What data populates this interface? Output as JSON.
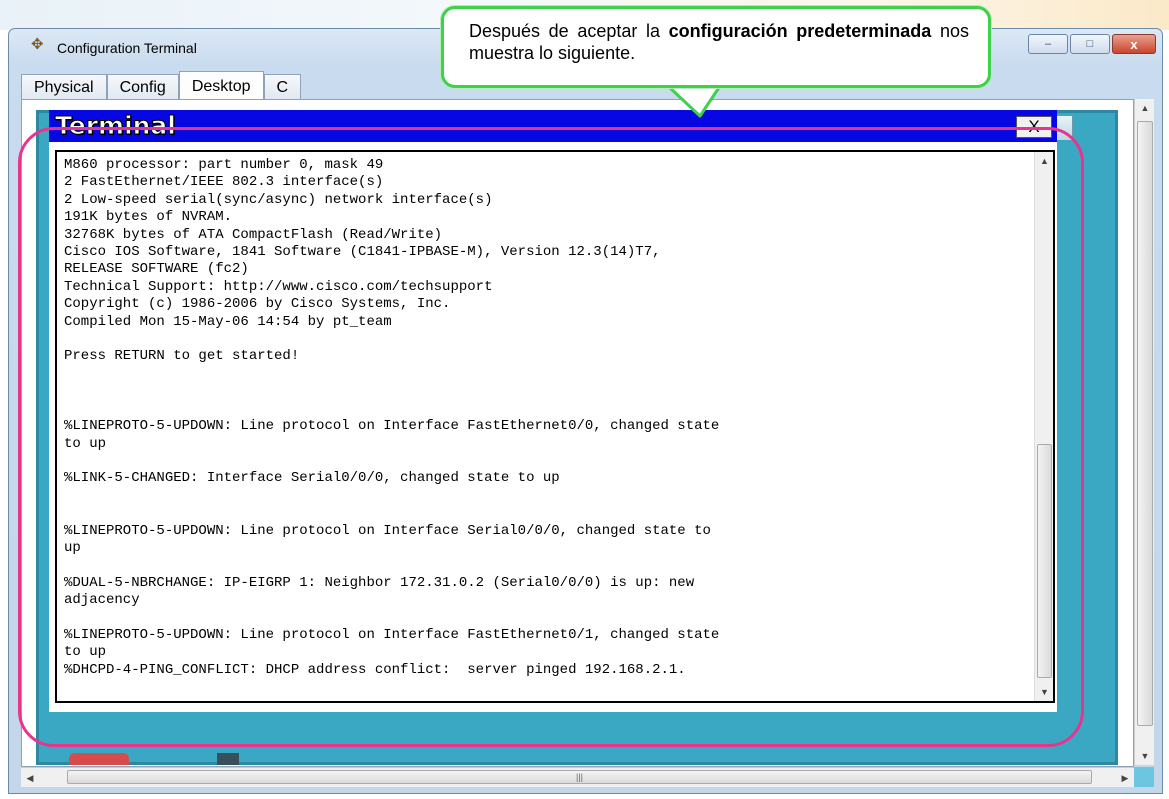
{
  "window": {
    "title": "Configuration Terminal",
    "controls": {
      "minimize": "–",
      "maximize": "□",
      "close": "x"
    }
  },
  "tabs": [
    {
      "label": "Physical",
      "active": false
    },
    {
      "label": "Config",
      "active": false
    },
    {
      "label": "Desktop",
      "active": true
    },
    {
      "label": "C",
      "active": false
    }
  ],
  "terminal": {
    "title": "Terminal",
    "close_label": "X",
    "output": "M860 processor: part number 0, mask 49\n2 FastEthernet/IEEE 802.3 interface(s)\n2 Low-speed serial(sync/async) network interface(s)\n191K bytes of NVRAM.\n32768K bytes of ATA CompactFlash (Read/Write)\nCisco IOS Software, 1841 Software (C1841-IPBASE-M), Version 12.3(14)T7,\nRELEASE SOFTWARE (fc2)\nTechnical Support: http://www.cisco.com/techsupport\nCopyright (c) 1986-2006 by Cisco Systems, Inc.\nCompiled Mon 15-May-06 14:54 by pt_team\n\nPress RETURN to get started!\n\n\n\n%LINEPROTO-5-UPDOWN: Line protocol on Interface FastEthernet0/0, changed state\nto up\n\n%LINK-5-CHANGED: Interface Serial0/0/0, changed state to up\n\n\n%LINEPROTO-5-UPDOWN: Line protocol on Interface Serial0/0/0, changed state to\nup\n\n%DUAL-5-NBRCHANGE: IP-EIGRP 1: Neighbor 172.31.0.2 (Serial0/0/0) is up: new\nadjacency\n\n%LINEPROTO-5-UPDOWN: Line protocol on Interface FastEthernet0/1, changed state\nto up\n%DHCPD-4-PING_CONFLICT: DHCP address conflict:  server pinged 192.168.2.1."
  },
  "callout": {
    "text_before": "Después de aceptar la",
    "text_bold": "configuración predeterminada",
    "text_after": "nos muestra lo siguiente."
  },
  "colors": {
    "terminal_bar": "#0707e4",
    "desktop_bg": "#3aa8c2",
    "highlight": "#e8338f",
    "callout_border": "#3fd14a"
  }
}
